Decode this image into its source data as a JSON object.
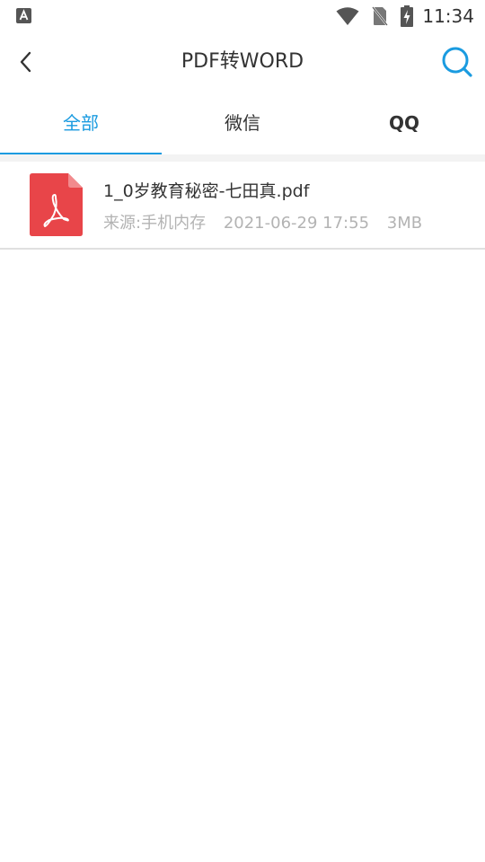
{
  "status_bar": {
    "time": "11:34",
    "left_icon": "font-a-icon",
    "icons": [
      "wifi-icon",
      "no-sim-icon",
      "battery-charging-icon"
    ]
  },
  "app_bar": {
    "title": "PDF转WORD",
    "back_icon": "back-chevron-icon",
    "search_icon": "search-icon"
  },
  "tabs": [
    {
      "label": "全部",
      "active": true
    },
    {
      "label": "微信",
      "active": false
    },
    {
      "label": "QQ",
      "active": false
    }
  ],
  "files": [
    {
      "name": "1_0岁教育秘密-七田真.pdf",
      "source": "来源:手机内存",
      "date": "2021-06-29 17:55",
      "size": "3MB",
      "icon": "pdf-file-icon"
    }
  ],
  "colors": {
    "accent": "#1a9be0",
    "pdf_red": "#e84549",
    "text_primary": "#333333",
    "text_secondary": "#b3b3b3"
  }
}
